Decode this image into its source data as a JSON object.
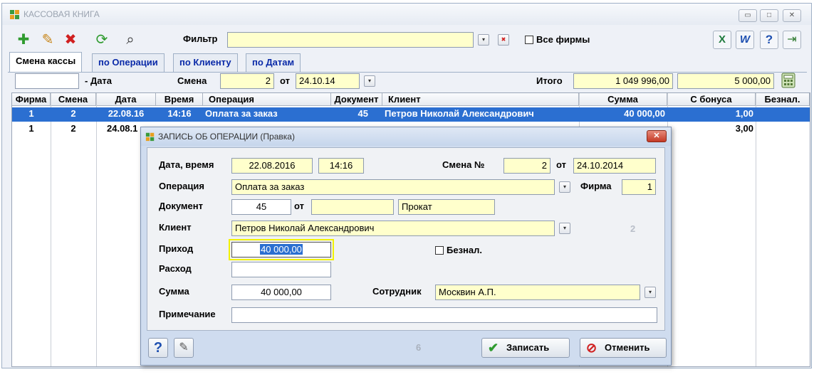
{
  "window": {
    "title": "КАССОВАЯ КНИГА",
    "controls": {
      "min": "▭",
      "max": "□",
      "close": "✕"
    }
  },
  "toolbar": {
    "filter_label": "Фильтр",
    "filter_value": "",
    "all_firms_label": "Все фирмы",
    "glyphs": {
      "add": "✚",
      "edit": "✎",
      "delete": "✖",
      "refresh": "⟳",
      "search": "⌕",
      "excel": "X",
      "word": "W",
      "help": "?",
      "exit": "⇥",
      "clear": "✖",
      "dropdown": "▾"
    }
  },
  "tabs": [
    {
      "label": "Смена кассы",
      "active": true
    },
    {
      "label": "по Операции",
      "active": false
    },
    {
      "label": "по Клиенту",
      "active": false
    },
    {
      "label": "по Датам",
      "active": false
    }
  ],
  "shift_bar": {
    "date_value": "",
    "date_label": "- Дата",
    "shift_label": "Смена",
    "shift_value": "2",
    "from_label": "от",
    "from_value": "24.10.14",
    "total_label": "Итого",
    "total_value": "1 049 996,00",
    "bonus_total": "5 000,00"
  },
  "grid": {
    "columns": [
      "Фирма",
      "Смена",
      "Дата",
      "Время",
      "Операция",
      "Документ",
      "Клиент",
      "Сумма",
      "С бонуса",
      "Безнал."
    ],
    "rows": [
      {
        "firm": "1",
        "shift": "2",
        "date": "22.08.16",
        "time": "14:16",
        "operation": "Оплата за заказ",
        "document": "45",
        "client": "Петров Николай Александрович",
        "amount": "40 000,00",
        "bonus": "1,00",
        "noncash": ""
      },
      {
        "firm": "1",
        "shift": "2",
        "date": "24.08.1",
        "time": "",
        "operation": "",
        "document": "",
        "client": "",
        "amount": "",
        "bonus": "3,00",
        "noncash": ""
      }
    ]
  },
  "dialog": {
    "title": "ЗАПИСЬ ОБ ОПЕРАЦИИ (Правка)",
    "close_glyph": "✕",
    "date_time_label": "Дата, время",
    "date": "22.08.2016",
    "time": "14:16",
    "shift_no_label": "Смена №",
    "shift_no": "2",
    "from_label": "от",
    "shift_date": "24.10.2014",
    "operation_label": "Операция",
    "operation": "Оплата за заказ",
    "firm_label": "Фирма",
    "firm": "1",
    "document_label": "Документ",
    "document_no": "45",
    "doc_from_label": "от",
    "doc_date": "",
    "doc_type": "Прокат",
    "client_label": "Клиент",
    "client": "Петров Николай Александрович",
    "client_aux": "2",
    "income_label": "Приход",
    "income": "40 000,00",
    "noncash_label": "Безнал.",
    "expense_label": "Расход",
    "expense": "",
    "sum_label": "Сумма",
    "sum": "40 000,00",
    "employee_label": "Сотрудник",
    "employee": "Москвин А.П.",
    "note_label": "Примечание",
    "note": "",
    "footer_counter": "6",
    "save_label": "Записать",
    "cancel_label": "Отменить",
    "help_glyph": "?",
    "tool_glyph": "✎",
    "save_glyph": "✔",
    "cancel_glyph": "⊘",
    "dropdown": "▾"
  },
  "colors": {
    "accent": "#2b6fd1",
    "field_yellow": "#ffffcc",
    "tab_link": "#0a2aa8"
  }
}
